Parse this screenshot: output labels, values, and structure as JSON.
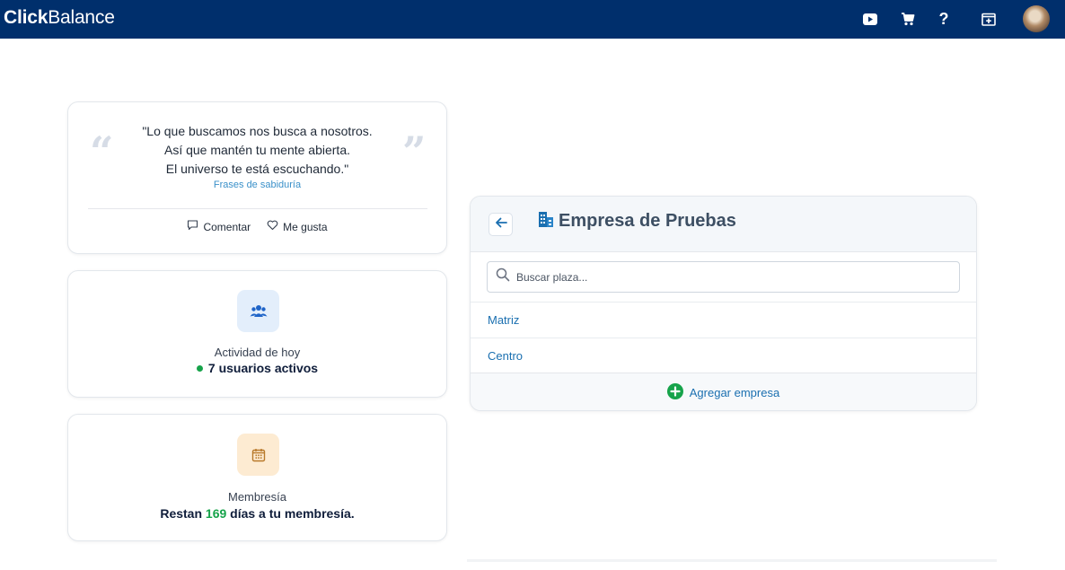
{
  "topbar": {
    "brand_bold": "Click",
    "brand_light": "Balance",
    "icons": [
      "youtube-icon",
      "cart-icon",
      "help-icon",
      "calendar-add-icon"
    ]
  },
  "quote": {
    "lines": [
      "\"Lo que buscamos nos busca a nosotros.",
      "Así que mantén tu mente abierta.",
      "El universo te está escuchando.\""
    ],
    "source": "Frases de sabiduría",
    "comment_label": "Comentar",
    "like_label": "Me gusta"
  },
  "activity": {
    "label": "Actividad de hoy",
    "value": "7 usuarios activos"
  },
  "membership": {
    "label": "Membresía",
    "prefix": "Restan",
    "days": "169",
    "suffix": "días a tu membresía."
  },
  "company": {
    "title": "Empresa de Pruebas",
    "search_placeholder": "Buscar plaza...",
    "plazas": [
      "Matriz",
      "Centro"
    ],
    "add_label": "Agregar empresa"
  },
  "colors": {
    "brand": "#002f6c",
    "accent_green": "#16a34a",
    "link_blue": "#1a6fb0"
  }
}
